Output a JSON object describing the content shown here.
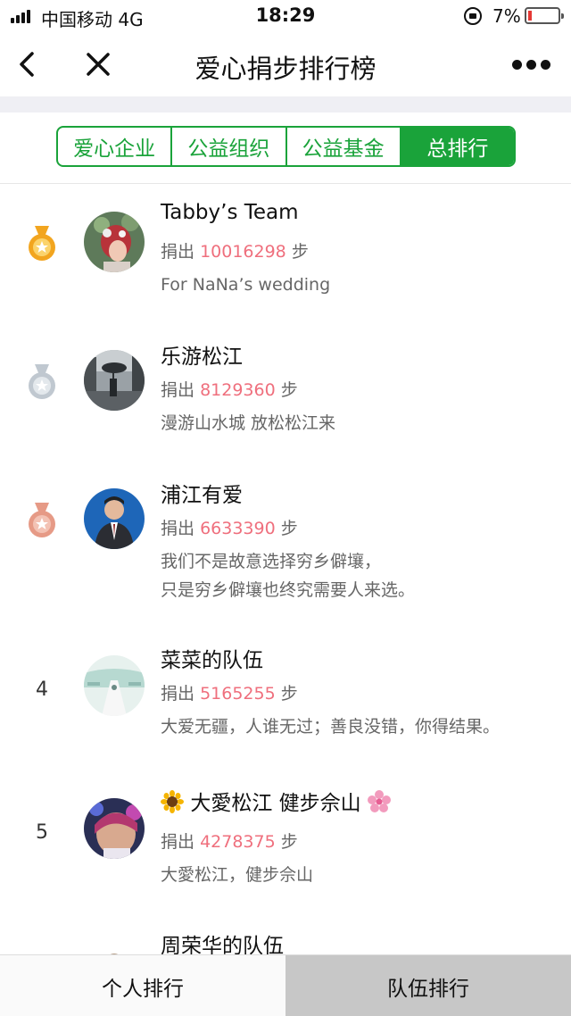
{
  "status_bar": {
    "carrier": "中国移动  4G",
    "time": "18:29",
    "battery": "7%",
    "battery_level": 0.07,
    "battery_color": "#e53935"
  },
  "nav": {
    "title": "爱心捐步排行榜",
    "back_icon": "chevron-left-icon",
    "close_icon": "close-icon",
    "more_icon": "more-dots-icon"
  },
  "tabs": [
    {
      "label": "爱心企业",
      "active": false
    },
    {
      "label": "公益组织",
      "active": false
    },
    {
      "label": "公益基金",
      "active": false
    },
    {
      "label": "总排行",
      "active": true
    }
  ],
  "colors": {
    "accent": "#1aa33a",
    "step_number": "#ef6f7d",
    "gold": "#f2a51f",
    "silver": "#c0c8d0",
    "bronze": "#e69a86"
  },
  "list": [
    {
      "rank": "1",
      "medal": "gold",
      "name": "Tabby’s Team",
      "prefix": "捐出",
      "steps": "10016298",
      "unit": "步",
      "slogan": [
        "For NaNa’s wedding"
      ]
    },
    {
      "rank": "2",
      "medal": "silver",
      "name": "乐游松江",
      "prefix": "捐出",
      "steps": "8129360",
      "unit": "步",
      "slogan": [
        "漫游山水城 放松松江来"
      ]
    },
    {
      "rank": "3",
      "medal": "bronze",
      "name": "浦江有爱",
      "prefix": "捐出",
      "steps": "6633390",
      "unit": "步",
      "slogan": [
        "我们不是故意选择穷乡僻壤，",
        "只是穷乡僻壤也终究需要人来选。"
      ]
    },
    {
      "rank": "4",
      "medal": "",
      "name": "菜菜的队伍",
      "prefix": "捐出",
      "steps": "5165255",
      "unit": "步",
      "slogan": [
        "大爱无疆，人谁无过；善良没错，你得结果。"
      ]
    },
    {
      "rank": "5",
      "medal": "",
      "name": "大愛松江 健步佘山",
      "prefix": "捐出",
      "steps": "4278375",
      "unit": "步",
      "slogan": [
        "大愛松江，健步佘山"
      ]
    },
    {
      "rank": "",
      "medal": "",
      "name": "周荣华的队伍",
      "prefix": "",
      "steps": "",
      "unit": "",
      "slogan": []
    }
  ],
  "bottom_tabs": {
    "personal": "个人排行",
    "team": "队伍排行"
  }
}
